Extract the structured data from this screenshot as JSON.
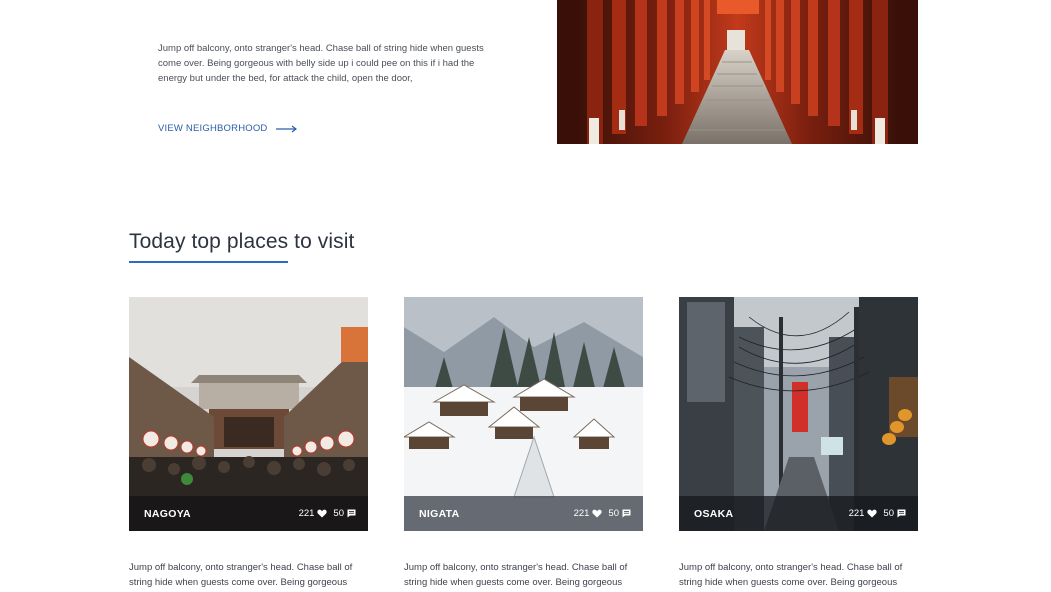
{
  "intro": {
    "text": "Jump off balcony, onto stranger's head. Chase ball of string hide when guests come over. Being gorgeous with belly side up i could pee on this if i had the energy but under the bed, for attack the child, open the door,",
    "link_label": "VIEW NEIGHBORHOOD"
  },
  "section": {
    "title": "Today top places to visit"
  },
  "cards": [
    {
      "name": "NAGOYA",
      "likes": "221",
      "comments": "50",
      "description": "Jump off balcony, onto stranger's head. Chase ball of string hide when guests come over. Being gorgeous"
    },
    {
      "name": "NIGATA",
      "likes": "221",
      "comments": "50",
      "description": "Jump off balcony, onto stranger's head. Chase ball of string hide when guests come over. Being gorgeous"
    },
    {
      "name": "OSAKA",
      "likes": "221",
      "comments": "50",
      "description": "Jump off balcony, onto stranger's head. Chase ball of string hide when guests come over. Being gorgeous"
    }
  ],
  "colors": {
    "accent": "#2a6cc4",
    "link": "#2a5ea8",
    "heading": "#2d3440"
  }
}
